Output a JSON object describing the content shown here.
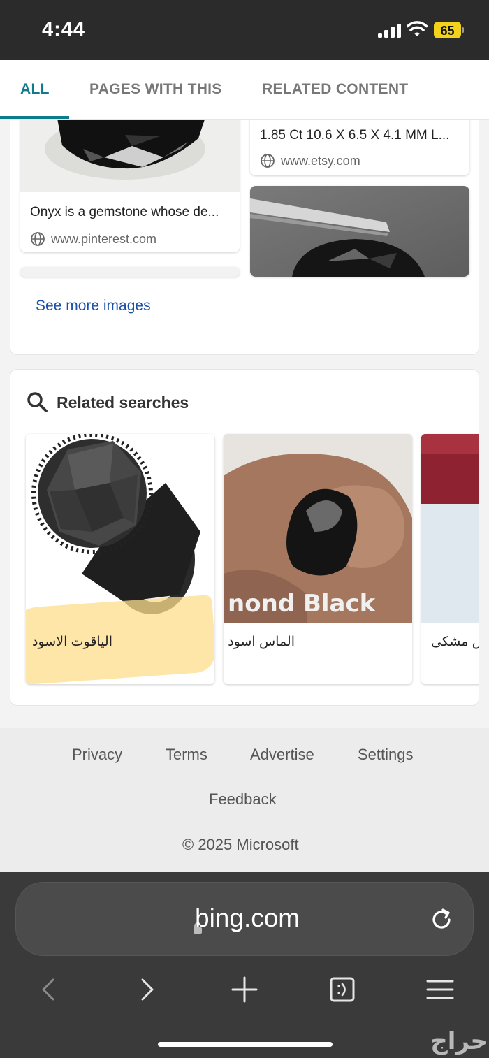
{
  "status": {
    "time": "4:44",
    "battery": "65"
  },
  "tabs": [
    {
      "label": "ALL"
    },
    {
      "label": "PAGES WITH THIS"
    },
    {
      "label": "RELATED CONTENT"
    }
  ],
  "images": {
    "items": [
      {
        "title": "Onyx is a gemstone whose de...",
        "source": "www.pinterest.com"
      },
      {
        "title": "1.85 Ct 10.6 X 6.5 X 4.1 MM L...",
        "source": "www.etsy.com"
      }
    ],
    "see_more": "See more images"
  },
  "related": {
    "title": "Related searches",
    "items": [
      {
        "label": "الياقوت الاسود"
      },
      {
        "label": "الماس اسود",
        "overlay": "nond Black"
      },
      {
        "label": "الماس مشکی"
      }
    ]
  },
  "footer": {
    "links": [
      "Privacy",
      "Terms",
      "Advertise",
      "Settings",
      "Feedback"
    ],
    "copyright": "© 2025 Microsoft"
  },
  "browser": {
    "url": "bing.com"
  },
  "watermark": "حراج"
}
